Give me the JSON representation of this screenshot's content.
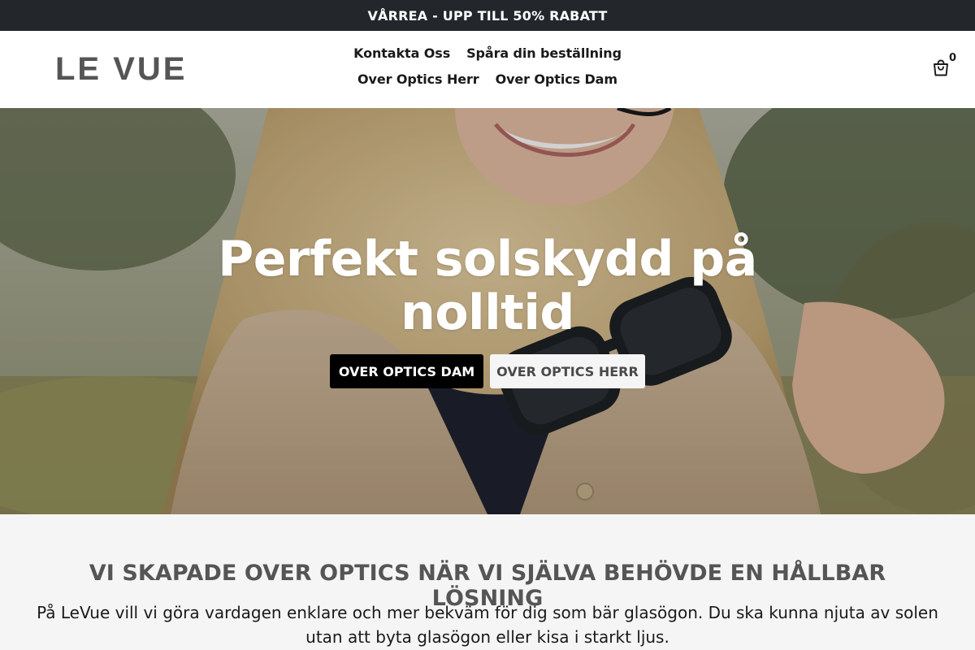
{
  "announcement": {
    "text": "VÅRREA - UPP TILL 50% RABATT"
  },
  "header": {
    "logo": "LE VUE",
    "nav": [
      {
        "label": "Kontakta Oss"
      },
      {
        "label": "Spåra din beställning"
      },
      {
        "label": "Over Optics Herr"
      },
      {
        "label": "Over Optics Dam"
      }
    ],
    "cart": {
      "icon": "shopping-bag-icon",
      "count": "0"
    }
  },
  "hero": {
    "title": "Perfekt solskydd på nolltid",
    "buttons": {
      "primary": "OVER OPTICS DAM",
      "secondary": "OVER OPTICS HERR"
    }
  },
  "info": {
    "heading": "VI SKAPADE OVER OPTICS NÄR VI SJÄLVA BEHÖVDE EN HÅLLBAR LÖSNING",
    "text": "På LeVue vill vi göra vardagen enklare och mer bekväm för dig som bär glasögon. Du ska kunna njuta av solen utan att byta glasögon eller kisa i starkt ljus."
  },
  "colors": {
    "announcement_bg": "#23272b",
    "primary_button_bg": "#000000",
    "secondary_button_bg": "#f5f5f5",
    "info_bg": "#f5f5f5",
    "heading_gray": "#555555"
  }
}
